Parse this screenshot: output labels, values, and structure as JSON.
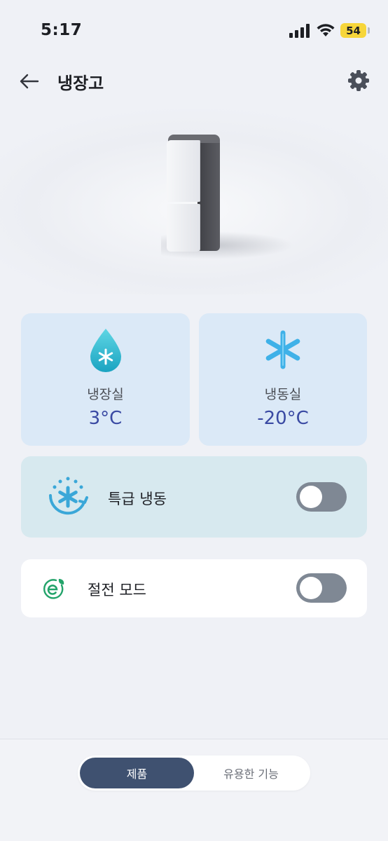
{
  "status_bar": {
    "time": "5:17",
    "battery": "54"
  },
  "header": {
    "title": "냉장고",
    "back_icon": "arrow-left-icon",
    "settings_icon": "gear-icon"
  },
  "compartments": [
    {
      "label": "냉장실",
      "value": "3°C",
      "icon": "water-drop-snowflake-icon"
    },
    {
      "label": "냉동실",
      "value": "-20°C",
      "icon": "snowflake-icon"
    }
  ],
  "express_freeze": {
    "label": "특급 냉동",
    "enabled": false,
    "icon": "express-freeze-icon"
  },
  "power_saving": {
    "label": "절전 모드",
    "enabled": false,
    "icon": "eco-leaf-icon"
  },
  "tabs": [
    {
      "label": "제품",
      "selected": true
    },
    {
      "label": "유용한 기능",
      "selected": false
    }
  ],
  "colors": {
    "accent": "#3f5170",
    "value_text": "#3a4aa3",
    "card_blue": "#dbe9f7",
    "card_teal": "#d7e9ef",
    "toggle_off": "#7f8894",
    "battery": "#f7d63a"
  }
}
